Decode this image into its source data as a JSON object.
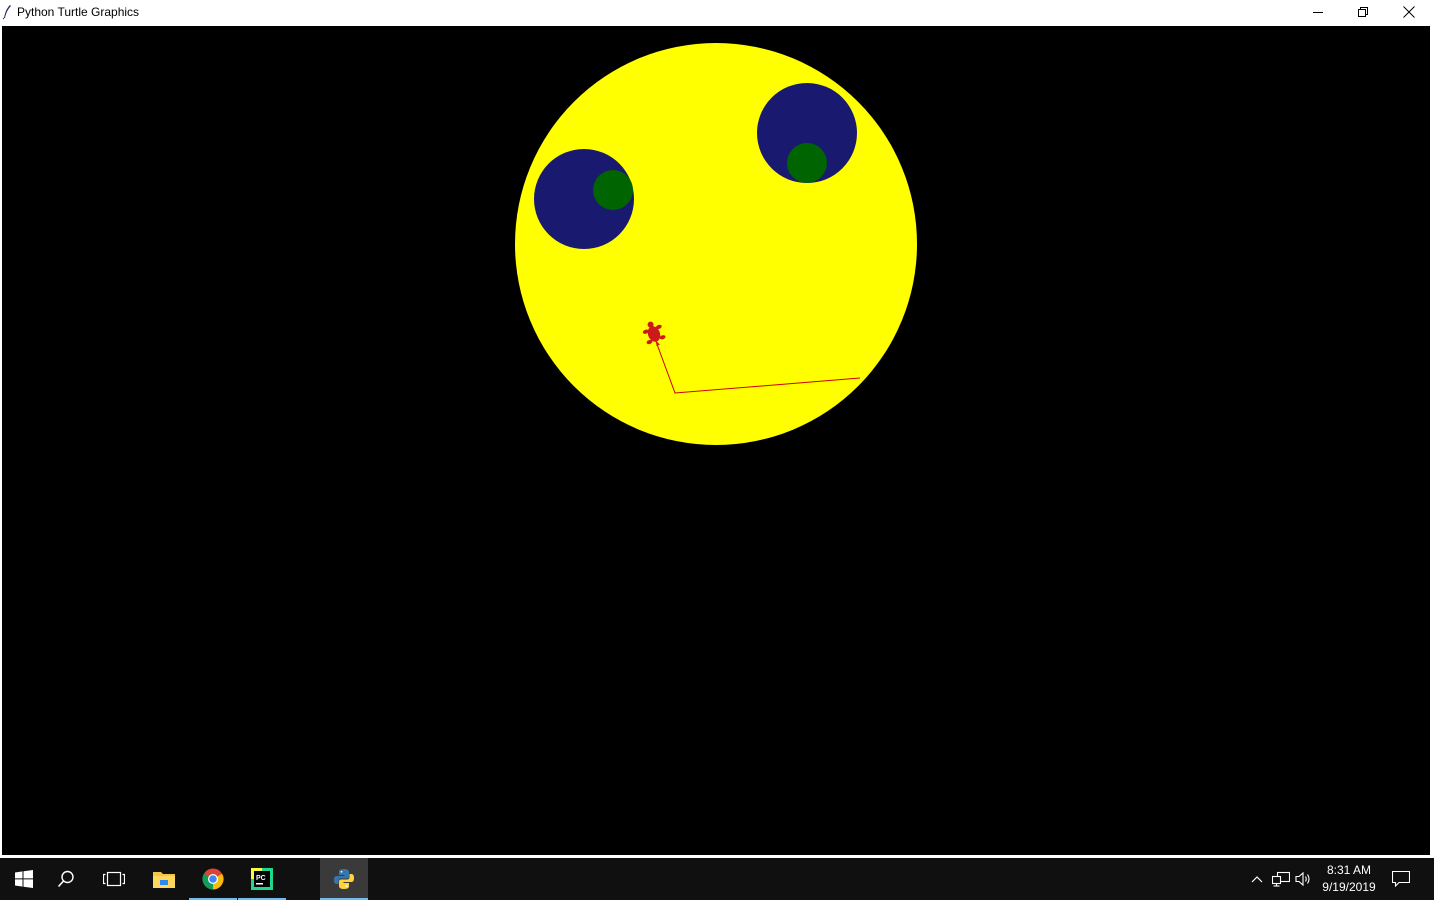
{
  "window": {
    "title": "Python Turtle Graphics",
    "controls": [
      "minimize",
      "restore",
      "close"
    ]
  },
  "canvas": {
    "background": "#000000",
    "face_color": "#ffff00",
    "eye_color": "#191970",
    "pupil_color": "#006400",
    "pen_color": "#cc0000",
    "turtle_color": "#cc1a1a"
  },
  "taskbar": {
    "pinned": [
      "windows-start-icon",
      "search-icon",
      "task-view-icon",
      "file-explorer-icon",
      "chrome-icon",
      "pycharm-icon",
      "python-icon"
    ],
    "tray": [
      "chevron-up-icon",
      "network-icon",
      "volume-icon",
      "notifications-icon"
    ],
    "clock": {
      "time": "8:31 AM",
      "date": "9/19/2019"
    }
  }
}
